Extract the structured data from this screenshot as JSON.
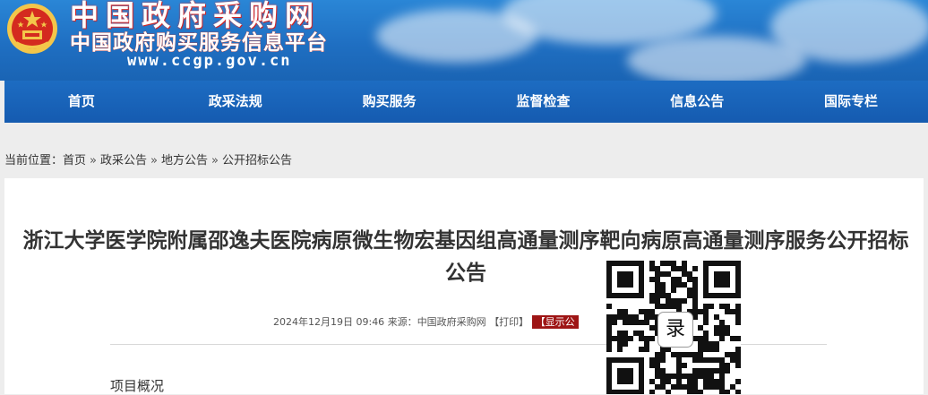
{
  "header": {
    "site_name": "中国政府采购网",
    "site_subtitle": "中国政府购买服务信息平台",
    "site_url": "www.ccgp.gov.cn"
  },
  "nav": {
    "items": [
      "首页",
      "政采法规",
      "购买服务",
      "监督检查",
      "信息公告",
      "国际专栏"
    ]
  },
  "breadcrumb": {
    "prefix": "当前位置：",
    "items": [
      "首页",
      "政采公告",
      "地方公告",
      "公开招标公告"
    ],
    "separator": "»"
  },
  "article": {
    "title": "浙江大学医学院附属邵逸夫医院病原微生物宏基因组高通量测序靶向病原高通量测序服务公开招标公告",
    "date": "2024年12月19日 09:46",
    "source_label": "来源：",
    "source": "中国政府采购网",
    "print_label": "【打印】",
    "show_label": "【显示公",
    "section_heading": "项目概况"
  },
  "overlay": {
    "qr_char": "录"
  },
  "colors": {
    "nav_blue": "#155bb0",
    "banner_blue": "#2a86d6",
    "show_red": "#9e1515",
    "emblem_red": "#d42a1f",
    "emblem_gold": "#f3c64a"
  }
}
